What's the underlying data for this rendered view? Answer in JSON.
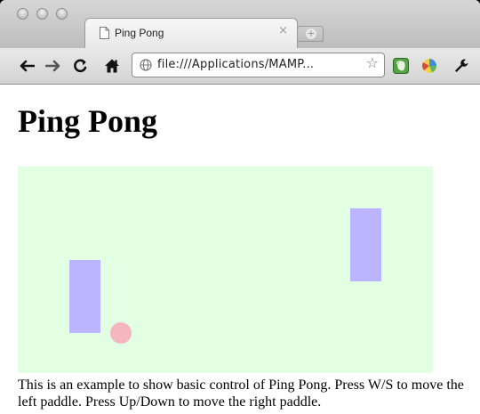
{
  "browser": {
    "tab": {
      "title": "Ping Pong",
      "close_glyph": "×",
      "favicon": "page-icon"
    },
    "new_tab": {
      "glyph": "+"
    },
    "toolbar": {
      "back_glyph": "←",
      "forward_glyph": "→",
      "reload_glyph": "C",
      "home_icon": "home-icon",
      "url": "file:///Applications/MAMP...",
      "bookmark_star_glyph": "☆",
      "extensions": [
        "evernote-icon",
        "extension-icon",
        "wrench-icon"
      ]
    }
  },
  "page": {
    "title": "Ping Pong",
    "game": {
      "background": "#e3ffe3",
      "paddle_color": "#bbb5ff",
      "ball_color": "#f4b7bf"
    },
    "description": "This is an example to show basic control of Ping Pong. Press W/S to move the left paddle. Press Up/Down to move the right paddle."
  }
}
